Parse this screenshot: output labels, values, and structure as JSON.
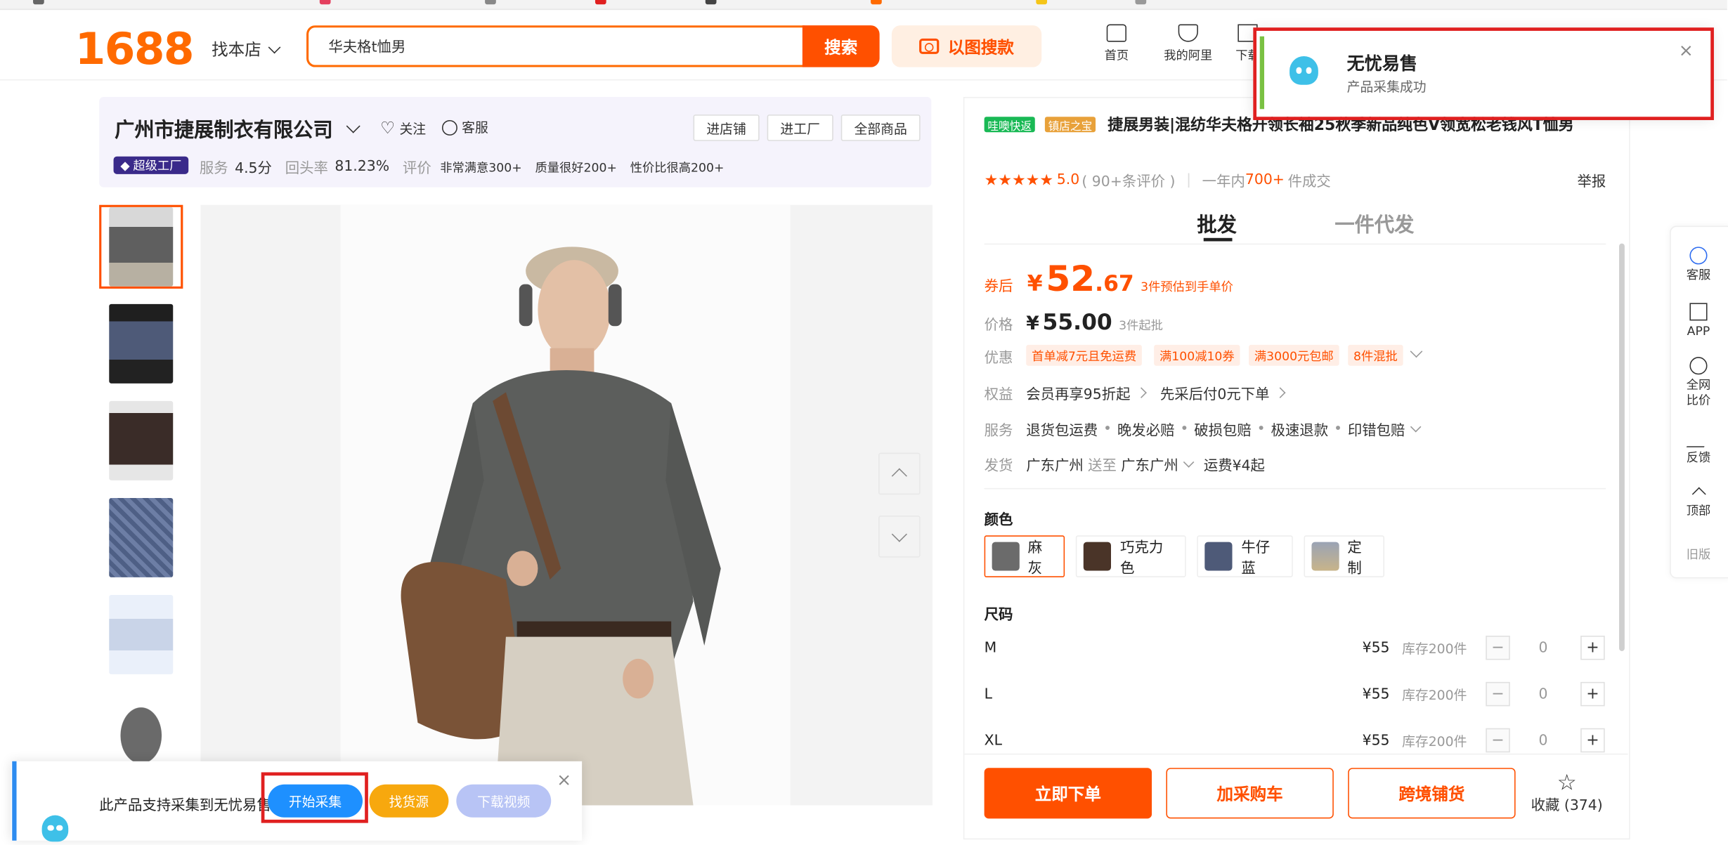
{
  "header": {
    "logo": "1688",
    "find_shop": "找本店",
    "search_value": "华夫格t恤男",
    "search_button": "搜索",
    "image_search_button": "以图搜款",
    "nav": [
      {
        "label": "首页",
        "icon": "home-icon"
      },
      {
        "label": "我的阿里",
        "icon": "shield-icon"
      },
      {
        "label": "下载",
        "icon": "download-icon"
      }
    ]
  },
  "notification": {
    "title": "无忧易售",
    "message": "产品采集成功",
    "close": "×"
  },
  "shop": {
    "name": "广州市捷展制衣有限公司",
    "follow": "关注",
    "service": "客服",
    "buttons": [
      "进店铺",
      "进工厂",
      "全部商品"
    ],
    "badge": "超级工厂",
    "service_label": "服务",
    "service_score": "4.5分",
    "repurchase_label": "回头率",
    "repurchase_value": "81.23%",
    "review_label": "评价",
    "review_tags": [
      "非常满意300+",
      "质量很好200+",
      "性价比很高200+"
    ]
  },
  "product": {
    "tag_fast": "哇噢快返",
    "tag_store": "镇店之宝",
    "title": "捷展男装|混纺华夫格开领长袖25秋季新品纯色V领宽松老钱风T恤男",
    "stars": "★★★★★",
    "rating": "5.0",
    "review_count": "( 90+条评价 )",
    "sold_prefix": "一年内",
    "sold_value": "700+",
    "sold_suffix": "件成交",
    "report": "举报",
    "tabs": [
      "批发",
      "一件代发"
    ],
    "coupon_label": "券后",
    "coupon_currency": "¥",
    "coupon_price_int": "52",
    "coupon_price_dec": ".67",
    "coupon_note": "3件预估到手单价",
    "price_label": "价格",
    "price_currency": "¥",
    "price": "55.00",
    "price_note": "3件起批",
    "promo_label": "优惠",
    "promos": [
      "首单减7元且免运费",
      "满100减10券",
      "满3000元包邮",
      "8件混批"
    ],
    "rights_label": "权益",
    "rights": [
      "会员再享95折起",
      "先采后付0元下单"
    ],
    "service_label": "服务",
    "services": [
      "退货包运费",
      "晚发必赔",
      "破损包赔",
      "极速退款",
      "印错包赔"
    ],
    "ship_label": "发货",
    "ship_from": "广东广州",
    "ship_to_label": "送至",
    "ship_to": "广东广州",
    "ship_fee": "运费¥4起",
    "color_title": "颜色",
    "colors": [
      {
        "name": "麻灰",
        "swatch": "#6b6b6b"
      },
      {
        "name": "巧克力色",
        "swatch": "#4a3428"
      },
      {
        "name": "牛仔蓝",
        "swatch": "#4e5a78"
      },
      {
        "name": "定制",
        "swatch": "#9aa3b5"
      }
    ],
    "size_title": "尺码",
    "sizes": [
      {
        "size": "M",
        "price": "¥55",
        "stock": "库存200件",
        "qty": "0"
      },
      {
        "size": "L",
        "price": "¥55",
        "stock": "库存200件",
        "qty": "0"
      },
      {
        "size": "XL",
        "price": "¥55",
        "stock": "库存200件",
        "qty": "0"
      }
    ],
    "buy_now": "立即下单",
    "add_cart": "加采购车",
    "cross_border": "跨境铺货",
    "collect": "收藏",
    "collect_count": "(374)"
  },
  "sidebar": [
    {
      "label": "客服",
      "icon": "chat-icon"
    },
    {
      "label": "APP",
      "icon": "qr-icon"
    },
    {
      "label": "全网比价",
      "icon": "compare-icon"
    },
    {
      "label": "反馈",
      "icon": "edit-icon"
    },
    {
      "label": "顶部",
      "icon": "top-icon"
    },
    {
      "label": "旧版",
      "icon": ""
    }
  ],
  "plugin": {
    "text": "此产品支持采集到无忧易售",
    "start": "开始采集",
    "find_source": "找货源",
    "download_video": "下载视频",
    "close": "×"
  },
  "colors": {
    "brand": "#ff5000",
    "logo": "#ff6a00",
    "highlight": "#e02020",
    "plugin_blue": "#2d8cf0"
  }
}
